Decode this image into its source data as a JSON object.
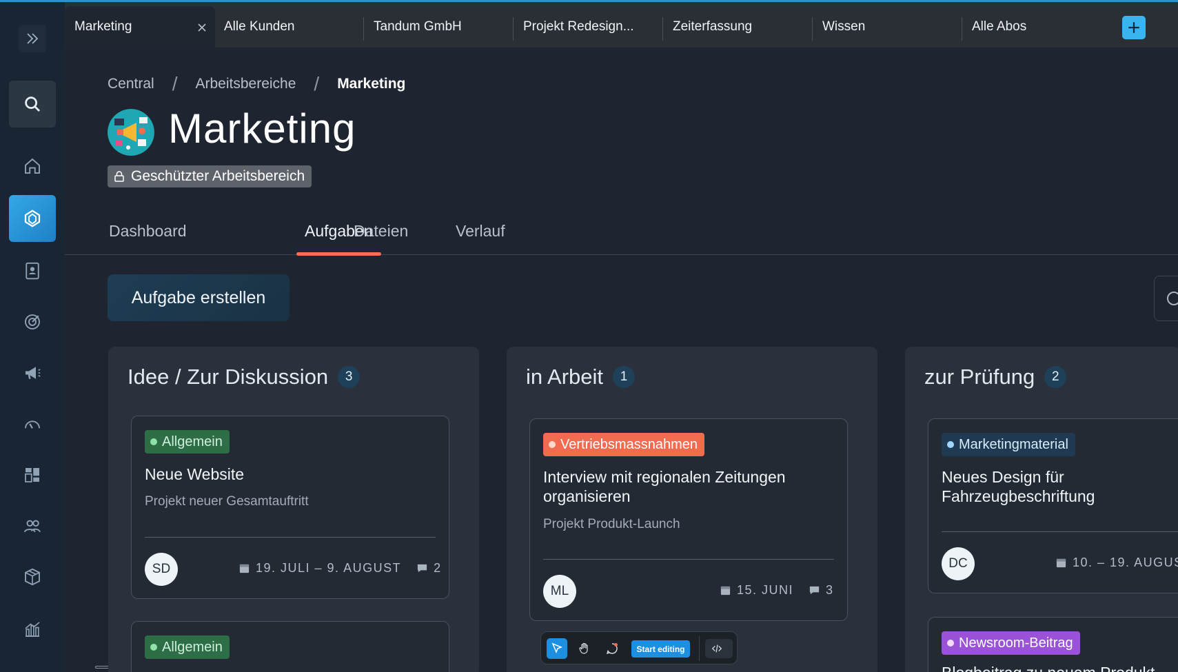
{
  "colors": {
    "accent": "#2b8fd6",
    "active_tab_underline": "#f2734f",
    "add_button": "#39b4ef"
  },
  "tabs": [
    {
      "label": "Marketing",
      "active": true
    },
    {
      "label": "Alle Kunden"
    },
    {
      "label": "Tandum GmbH"
    },
    {
      "label": "Projekt Redesign..."
    },
    {
      "label": "Zeiterfassung"
    },
    {
      "label": "Wissen"
    },
    {
      "label": "Alle Abos"
    }
  ],
  "sidebar": {
    "items": [
      "expand-icon",
      "search-icon",
      "home-icon",
      "workspace-icon",
      "contacts-icon",
      "target-icon",
      "megaphone-icon",
      "gauge-icon",
      "board-icon",
      "team-icon",
      "package-icon",
      "chart-icon"
    ]
  },
  "breadcrumb": [
    "Central",
    "Arbeitsbereiche",
    "Marketing"
  ],
  "header": {
    "title": "Marketing",
    "badge": "Geschützter Arbeitsbereich"
  },
  "subtabs": [
    {
      "label": "Dashboard"
    },
    {
      "label": "Aufgaben",
      "active": true
    },
    {
      "label": "Dateien"
    },
    {
      "label": "Verlauf"
    }
  ],
  "create_button": "Aufgabe erstellen",
  "columns": [
    {
      "title": "Idee / Zur Diskussion",
      "count": "3",
      "cards": [
        {
          "tag": "Allgemein",
          "tag_color": "#2e6e47",
          "tag_dot": "#8ee3a7",
          "tag_text": "#cfeedb",
          "title": "Neue Website",
          "subtitle": "Projekt neuer Gesamtauftritt",
          "avatar": "SD",
          "date": "19. JULI – 9. AUGUST",
          "comments": "2"
        },
        {
          "tag": "Allgemein",
          "tag_color": "#2e6e47",
          "tag_dot": "#8ee3a7",
          "tag_text": "#cfeedb"
        }
      ]
    },
    {
      "title": "in Arbeit",
      "count": "1",
      "cards": [
        {
          "tag": "Vertriebsmassnahmen",
          "tag_color": "#f26b4f",
          "tag_dot": "#ffd9cf",
          "tag_text": "#ffffff",
          "title_line1": "Interview mit regionalen Zeitungen",
          "title_line2": "organisieren",
          "subtitle": "Projekt Produkt-Launch",
          "avatar": "ML",
          "date": "15. JUNI",
          "comments": "3"
        }
      ]
    },
    {
      "title": "zur Prüfung",
      "count": "2",
      "cards": [
        {
          "tag": "Marketingmaterial",
          "tag_color": "#1f3a52",
          "tag_dot": "#9fd6ff",
          "tag_text": "#d6ecfb",
          "title_line1": "Neues Design für",
          "title_line2": "Fahrzeugbeschriftung",
          "avatar": "DC",
          "date": "10. – 19. AUGUS"
        },
        {
          "tag": "Newsroom-Beitrag",
          "tag_color": "#9a52d8",
          "tag_dot": "#f0dcff",
          "tag_text": "#ffffff",
          "title_partial": "Blogbeitrag zu neuem Produkt"
        }
      ]
    }
  ],
  "floating_toolbar": {
    "start_label": "Start editing"
  }
}
